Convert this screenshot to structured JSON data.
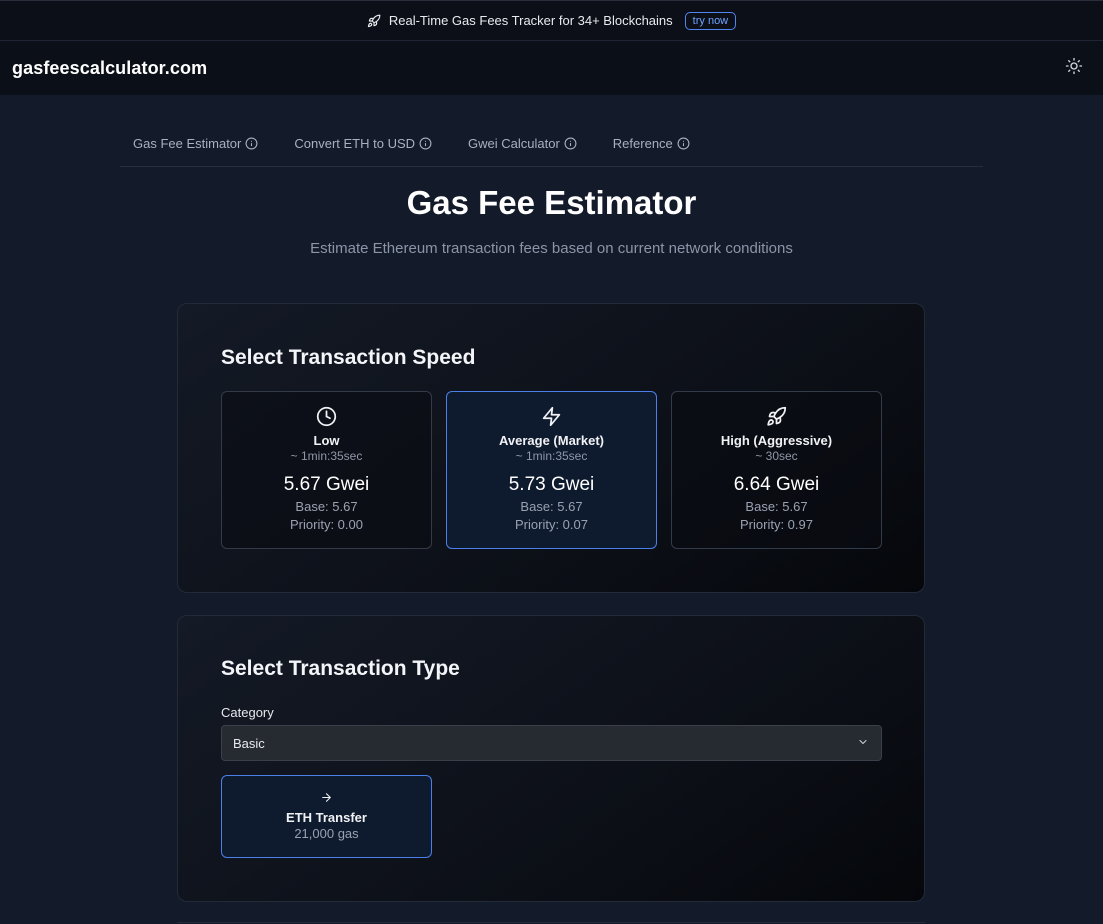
{
  "announcement": {
    "text": "Real-Time Gas Fees Tracker for 34+ Blockchains",
    "cta": "try now"
  },
  "header": {
    "logo": "gasfeescalculator.com",
    "theme_icon": "sun-icon"
  },
  "tabs": [
    {
      "label": "Gas Fee Estimator"
    },
    {
      "label": "Convert ETH to USD"
    },
    {
      "label": "Gwei Calculator"
    },
    {
      "label": "Reference"
    }
  ],
  "page": {
    "title": "Gas Fee Estimator",
    "subtitle": "Estimate Ethereum transaction fees based on current network conditions"
  },
  "speed_section": {
    "title": "Select Transaction Speed",
    "options": [
      {
        "icon": "clock-icon",
        "name": "Low",
        "time": "~ 1min:35sec",
        "gwei": "5.67 Gwei",
        "base": "Base: 5.67",
        "priority": "Priority: 0.00",
        "selected": false
      },
      {
        "icon": "lightning-icon",
        "name": "Average (Market)",
        "time": "~ 1min:35sec",
        "gwei": "5.73 Gwei",
        "base": "Base: 5.67",
        "priority": "Priority: 0.07",
        "selected": true
      },
      {
        "icon": "rocket-icon",
        "name": "High (Aggressive)",
        "time": "~ 30sec",
        "gwei": "6.64 Gwei",
        "base": "Base: 5.67",
        "priority": "Priority: 0.97",
        "selected": false
      }
    ]
  },
  "type_section": {
    "title": "Select Transaction Type",
    "category_label": "Category",
    "category_value": "Basic",
    "options": [
      {
        "icon": "arrow-right-icon",
        "name": "ETH Transfer",
        "gas": "21,000 gas",
        "selected": true
      }
    ]
  },
  "colors": {
    "accent": "#4a80e8",
    "background": "#131a2a",
    "header": "#0b0f17"
  }
}
